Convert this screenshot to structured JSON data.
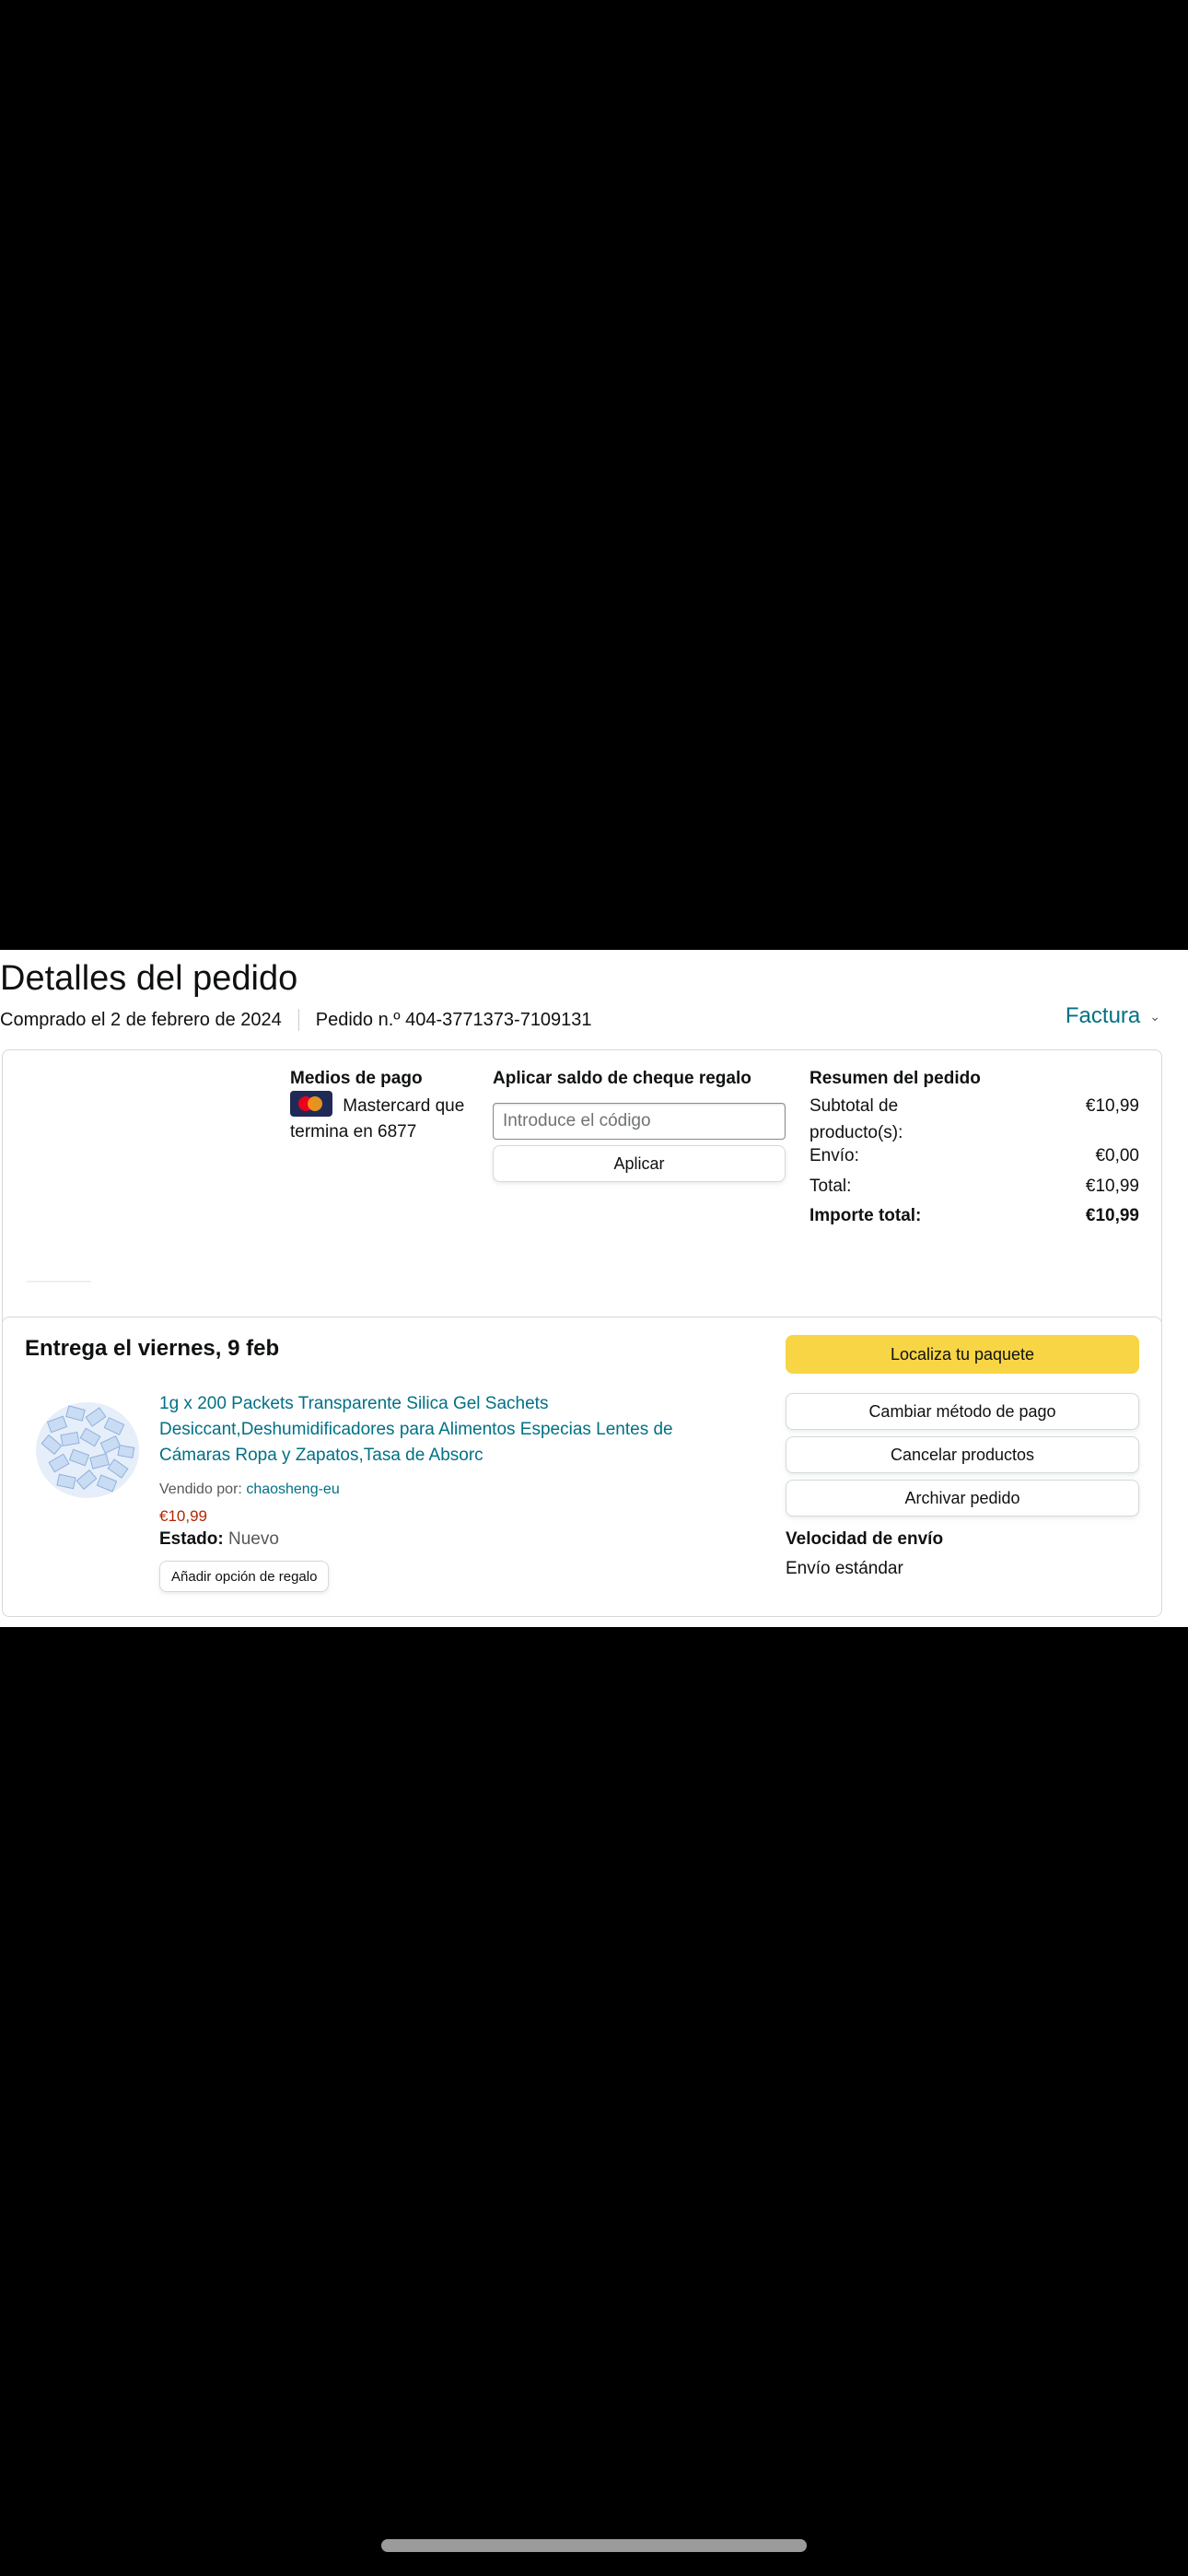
{
  "header": {
    "title": "Detalles del pedido",
    "purchased": "Comprado el 2 de febrero de 2024",
    "order_number": "Pedido n.º 404-3771373-7109131",
    "invoice": "Factura"
  },
  "payment": {
    "title": "Medios de pago",
    "card_line1": "Mastercard que",
    "card_line2": "termina en 6877",
    "card_icon": "mastercard-icon"
  },
  "gift": {
    "title": "Aplicar saldo de cheque regalo",
    "placeholder": "Introduce el código",
    "apply": "Aplicar"
  },
  "summary": {
    "title": "Resumen del pedido",
    "rows": [
      {
        "label": "Subtotal de producto(s):",
        "value": "€10,99"
      },
      {
        "label": "Envío:",
        "value": "€0,00"
      },
      {
        "label": "Total:",
        "value": "€10,99"
      },
      {
        "label": "Importe total:",
        "value": "€10,99"
      }
    ]
  },
  "shipment": {
    "delivery": "Entrega el viernes, 9 feb",
    "product_title": "1g x 200 Packets Transparente Silica Gel Sachets Desiccant,Deshumidificadores para Alimentos Especias Lentes de Cámaras Ropa y Zapatos,Tasa de Absorc",
    "sold_by_label": "Vendido por:",
    "seller": "chaosheng-eu",
    "price": "€10,99",
    "condition_label": "Estado:",
    "condition_value": "Nuevo",
    "gift_option": "Añadir opción de regalo",
    "track": "Localiza tu paquete",
    "change_payment": "Cambiar método de pago",
    "cancel": "Cancelar productos",
    "archive": "Archivar pedido",
    "speed_title": "Velocidad de envío",
    "speed_value": "Envío estándar"
  },
  "colors": {
    "accent_link": "#007185",
    "button_yellow": "#f7d544",
    "price_red": "#b12704"
  }
}
